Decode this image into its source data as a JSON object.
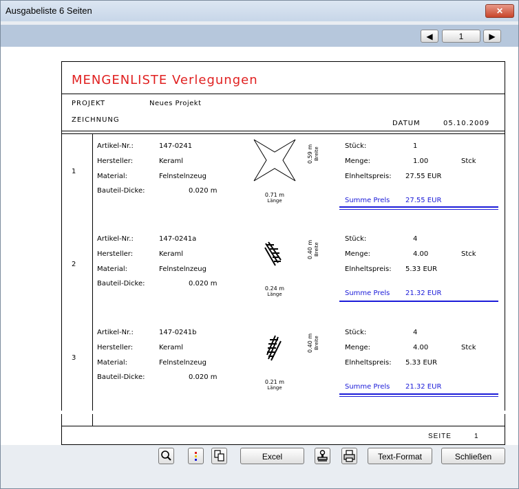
{
  "window": {
    "title": "Ausgabeliste 6 Seiten",
    "close_label": "✕"
  },
  "nav": {
    "prev_label": "◀",
    "page_value": "1",
    "next_label": "▶"
  },
  "document": {
    "title": "MENGENLISTE  Verlegungen",
    "projekt_label": "PROJEKT",
    "projekt_value": "Neues Projekt",
    "zeichnung_label": "ZEICHNUNG",
    "datum_label": "DATUM",
    "datum_value": "05.10.2009",
    "items": [
      {
        "num": "1",
        "artikel_label": "Artikel-Nr.:",
        "artikel": "147-0241",
        "hersteller_label": "Hersteller:",
        "hersteller": "Keraml",
        "material_label": "Material:",
        "material": "Felnstelnzeug",
        "dicke_label": "Bauteil-Dicke:",
        "dicke": "0.020 m",
        "breite_value": "0.59 m",
        "breite_label": "Breite",
        "laenge_value": "0.71 m",
        "laenge_label": "Länge",
        "stueck_label": "Stück:",
        "stueck": "1",
        "menge_label": "Menge:",
        "menge": "1.00",
        "menge_unit": "Stck",
        "preis_label": "Elnheltspreis:",
        "preis": "27.55 EUR",
        "summe_label": "Summe Prels",
        "summe": "27.55 EUR"
      },
      {
        "num": "2",
        "artikel_label": "Artikel-Nr.:",
        "artikel": "147-0241a",
        "hersteller_label": "Hersteller:",
        "hersteller": "Keraml",
        "material_label": "Material:",
        "material": "Felnstelnzeug",
        "dicke_label": "Bauteil-Dicke:",
        "dicke": "0.020 m",
        "breite_value": "0.40 m",
        "breite_label": "Breite",
        "laenge_value": "0.24 m",
        "laenge_label": "Länge",
        "stueck_label": "Stück:",
        "stueck": "4",
        "menge_label": "Menge:",
        "menge": "4.00",
        "menge_unit": "Stck",
        "preis_label": "Elnheltspreis:",
        "preis": "5.33 EUR",
        "summe_label": "Summe Prels",
        "summe": "21.32 EUR"
      },
      {
        "num": "3",
        "artikel_label": "Artikel-Nr.:",
        "artikel": "147-0241b",
        "hersteller_label": "Hersteller:",
        "hersteller": "Keraml",
        "material_label": "Material:",
        "material": "Felnstelnzeug",
        "dicke_label": "Bauteil-Dicke:",
        "dicke": "0.020 m",
        "breite_value": "0.40 m",
        "breite_label": "Breite",
        "laenge_value": "0.21 m",
        "laenge_label": "Länge",
        "stueck_label": "Stück:",
        "stueck": "4",
        "menge_label": "Menge:",
        "menge": "4.00",
        "menge_unit": "Stck",
        "preis_label": "Elnheltspreis:",
        "preis": "5.33 EUR",
        "summe_label": "Summe Prels",
        "summe": "21.32 EUR"
      }
    ],
    "seite_label": "SEITE",
    "seite_value": "1"
  },
  "buttons": {
    "search_icon": "magnifier-icon",
    "colors_icon": "color-dots-icon",
    "copy_icon": "copy-pages-icon",
    "excel_label": "Excel",
    "stamp_icon": "stamp-icon",
    "print_icon": "printer-icon",
    "textformat_label": "Text-Format",
    "close_label": "Schließen"
  },
  "colors": {
    "title_red": "#e02020",
    "sum_blue": "#1a1ad8",
    "navbar": "#b6c7dc"
  }
}
